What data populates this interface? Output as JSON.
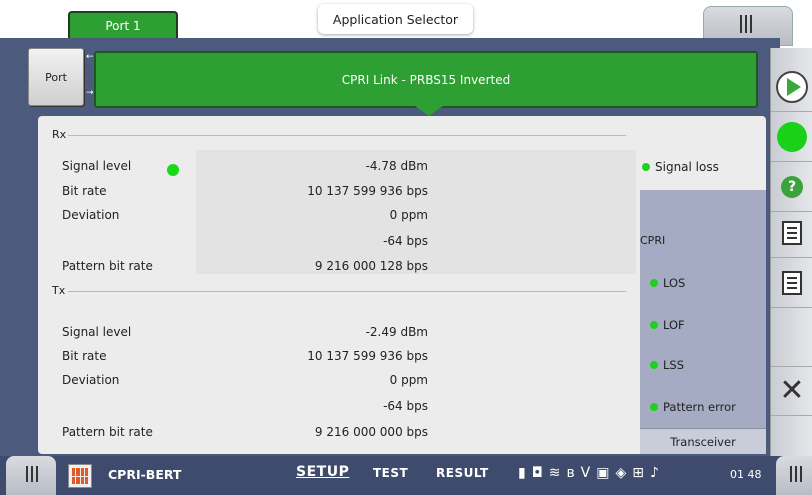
{
  "header": {
    "port_tab": "Port 1",
    "app_selector": "Application Selector"
  },
  "port_button": "Port",
  "link_title": "CPRI Link - PRBS15 Inverted",
  "rx": {
    "section": "Rx",
    "rows": [
      {
        "label": "Signal level",
        "value": "-4.78 dBm"
      },
      {
        "label": "Bit rate",
        "value": "10 137 599 936 bps"
      },
      {
        "label": "Deviation",
        "value": "0 ppm"
      },
      {
        "label": "",
        "value": "-64 bps"
      },
      {
        "label": "Pattern bit rate",
        "value": "9 216 000 128 bps"
      }
    ]
  },
  "tx": {
    "section": "Tx",
    "rows": [
      {
        "label": "Signal level",
        "value": "-2.49 dBm"
      },
      {
        "label": "Bit rate",
        "value": "10 137 599 936 bps"
      },
      {
        "label": "Deviation",
        "value": "0 ppm"
      },
      {
        "label": "",
        "value": "-64 bps"
      },
      {
        "label": "Pattern bit rate",
        "value": "9 216 000 000 bps"
      }
    ]
  },
  "signal_loss": "Signal loss",
  "cpri": {
    "title": "CPRI",
    "items": [
      "LOS",
      "LOF",
      "LSS",
      "Pattern error"
    ],
    "transceiver": "Transceiver"
  },
  "bottom": {
    "app_name": "CPRI-BERT",
    "tabs": [
      "SETUP",
      "TEST",
      "RESULT"
    ],
    "clock": "01 48"
  },
  "colors": {
    "accent_green": "#2e9f33",
    "led_green": "#1fd11f",
    "frame_blue": "#4c5a7e",
    "bottom_bar": "#3f4b6d"
  },
  "icons": [
    "run-icon",
    "status-led-icon",
    "help-icon",
    "report-icon",
    "notes-icon",
    "close-icon"
  ]
}
